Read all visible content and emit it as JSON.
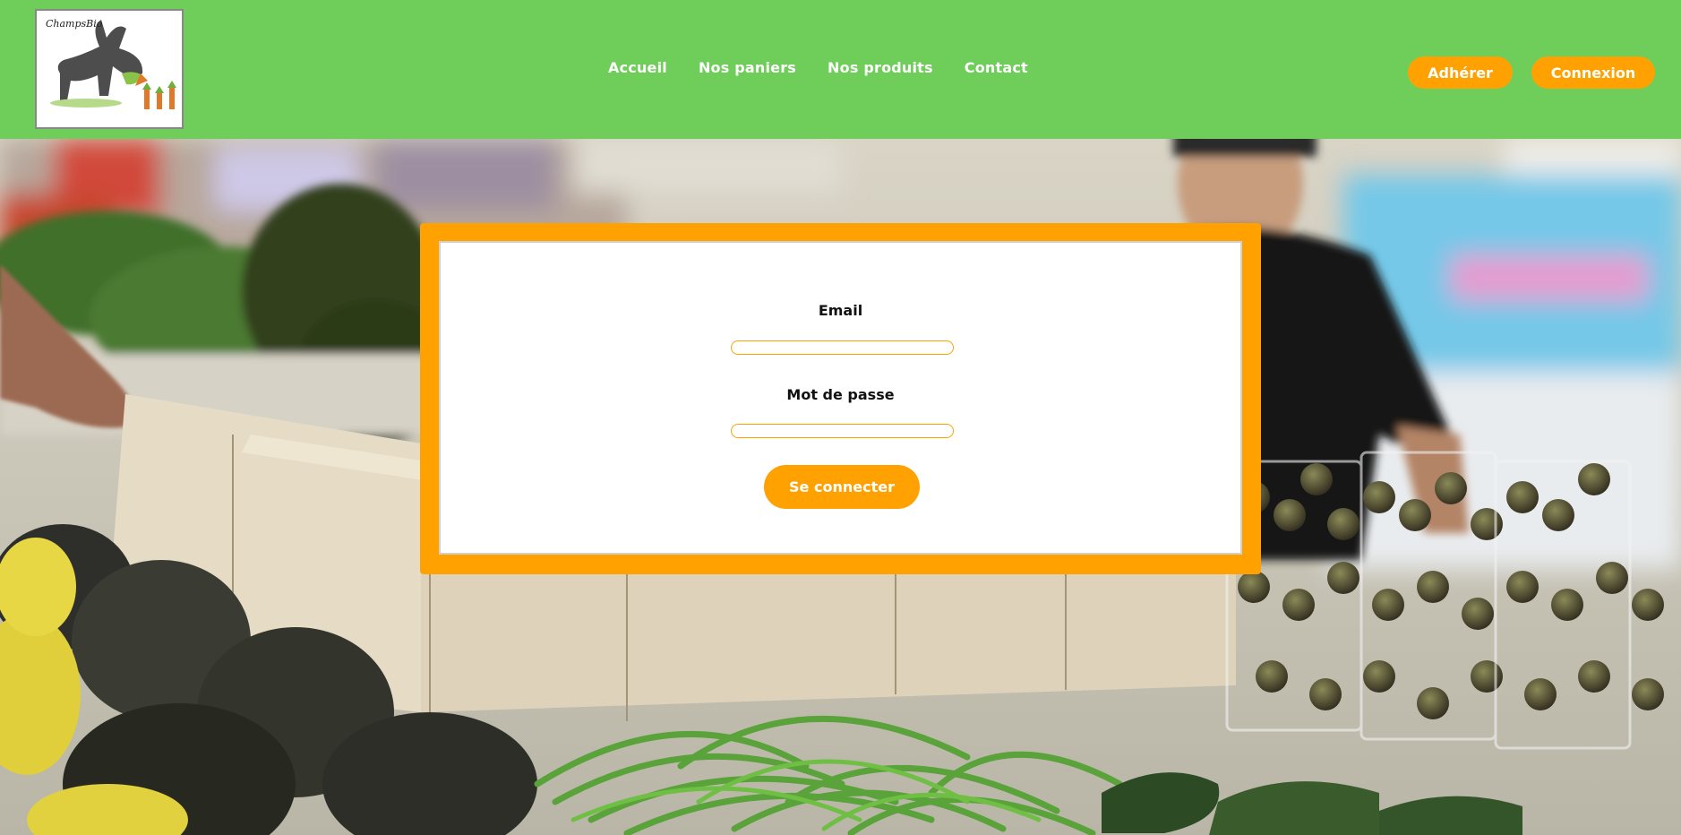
{
  "brand": {
    "logo_text": "ChampsBio"
  },
  "nav": {
    "items": [
      {
        "label": "Accueil"
      },
      {
        "label": "Nos paniers"
      },
      {
        "label": "Nos produits"
      },
      {
        "label": "Contact"
      }
    ]
  },
  "header_actions": {
    "join_label": "Adhérer",
    "login_label": "Connexion"
  },
  "login_form": {
    "email_label": "Email",
    "email_value": "",
    "password_label": "Mot de passe",
    "password_value": "",
    "submit_label": "Se connecter"
  },
  "colors": {
    "header_green": "#6fce5a",
    "accent_orange": "#ffa100",
    "card_white": "#ffffff"
  }
}
